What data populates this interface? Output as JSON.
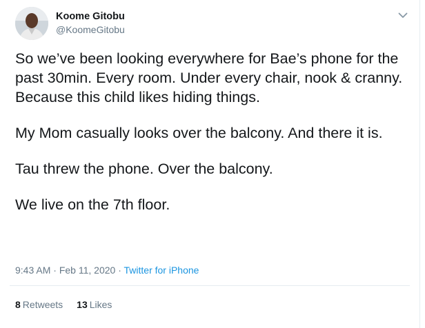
{
  "author": {
    "display_name": "Koome Gitobu",
    "handle": "@KoomeGitobu",
    "avatar_icon": "avatar-photo"
  },
  "menu": {
    "icon": "chevron-down-icon"
  },
  "tweet": {
    "paragraphs": [
      "So we’ve been looking everywhere for Bae’s phone for the past 30min. Every room. Under every chair, nook & cranny. Because this child likes hiding things.",
      "My Mom casually looks over the balcony. And there it is.",
      "Tau threw the phone. Over the balcony.",
      "We live on the 7th floor."
    ]
  },
  "meta": {
    "time": "9:43 AM",
    "separator": "·",
    "date": "Feb 11, 2020",
    "source": "Twitter for iPhone"
  },
  "stats": {
    "retweets_count": "8",
    "retweets_label": "Retweets",
    "likes_count": "13",
    "likes_label": "Likes"
  },
  "colors": {
    "text": "#14171a",
    "secondary": "#657786",
    "link": "#1b95e0",
    "divider": "#e6ecf0"
  }
}
